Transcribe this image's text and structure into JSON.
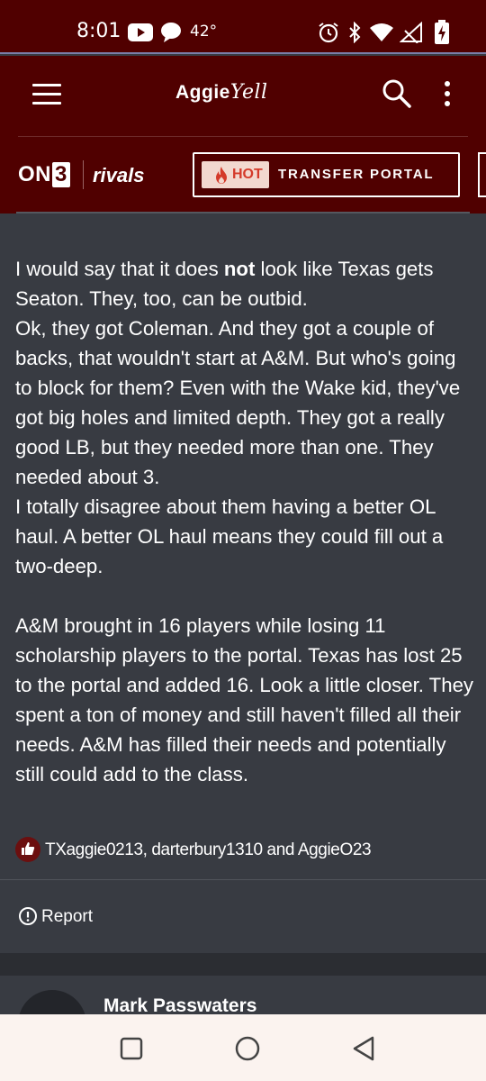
{
  "status_bar": {
    "time": "8:01",
    "temperature": "42°",
    "left_icons": [
      "youtube-icon",
      "chat-bubble-icon"
    ],
    "right_icons": [
      "alarm-icon",
      "bluetooth-icon",
      "wifi-icon",
      "signal-icon",
      "battery-charging-icon"
    ]
  },
  "header": {
    "logo_main": "Aggie",
    "logo_script": "Yell",
    "menu_icon": "hamburger-icon",
    "search_icon": "search-icon",
    "more_icon": "more-vertical-icon"
  },
  "brand_bar": {
    "on3_prefix": "ON",
    "on3_digit": "3",
    "rivals": "rivals",
    "hot_badge": "HOT",
    "transfer_portal": "TRANSFER PORTAL"
  },
  "post": {
    "paragraph1_before": "I would say that it does ",
    "paragraph1_bold": "not",
    "paragraph1_after": " look like Texas gets Seaton. They, too, can be outbid.",
    "paragraph2": "Ok, they got Coleman. And they got a couple of backs, that wouldn't start at A&M. But who's going to block for them? Even with the Wake kid, they've got big holes and limited depth. They got a really good LB, but they needed more than one. They needed about 3.",
    "paragraph3": "I totally disagree about them having a better OL haul. A better OL haul means they could fill out a two-deep.",
    "paragraph4": "A&M brought in 16 players while losing 11 scholarship players to the portal. Texas has lost 25 to the portal and added 16. Look a little closer. They spent a ton of money and still haven't filled all their needs. A&M has filled their needs and potentially still could add to the class.",
    "reactions": "TXaggie0213, darterbury1310 and AggieO23",
    "report_label": "Report"
  },
  "next_post": {
    "author": "Mark Passwaters"
  },
  "colors": {
    "brand_maroon": "#500000",
    "page_background": "#383b42",
    "hot_red": "#d43a2a"
  }
}
